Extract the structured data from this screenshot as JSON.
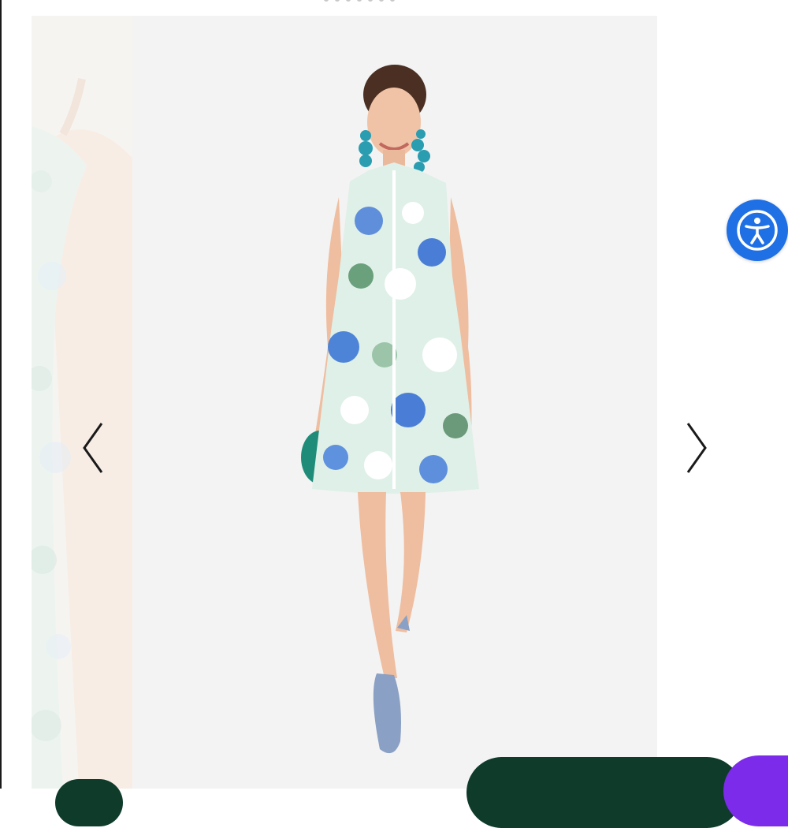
{
  "gallery": {
    "prev_arrow_icon": "chevron-left-icon",
    "next_arrow_icon": "chevron-right-icon",
    "main_image": "model-wearing-floral-sleeveless-dress",
    "prev_image": "floral-dress-back-detail"
  },
  "accessibility": {
    "icon": "accessibility-person-icon",
    "color": "#1f6fe5"
  },
  "colors": {
    "dark_green": "#0f3b2b",
    "purple": "#7d2bea",
    "slide_bg": "#f3f3f3"
  }
}
